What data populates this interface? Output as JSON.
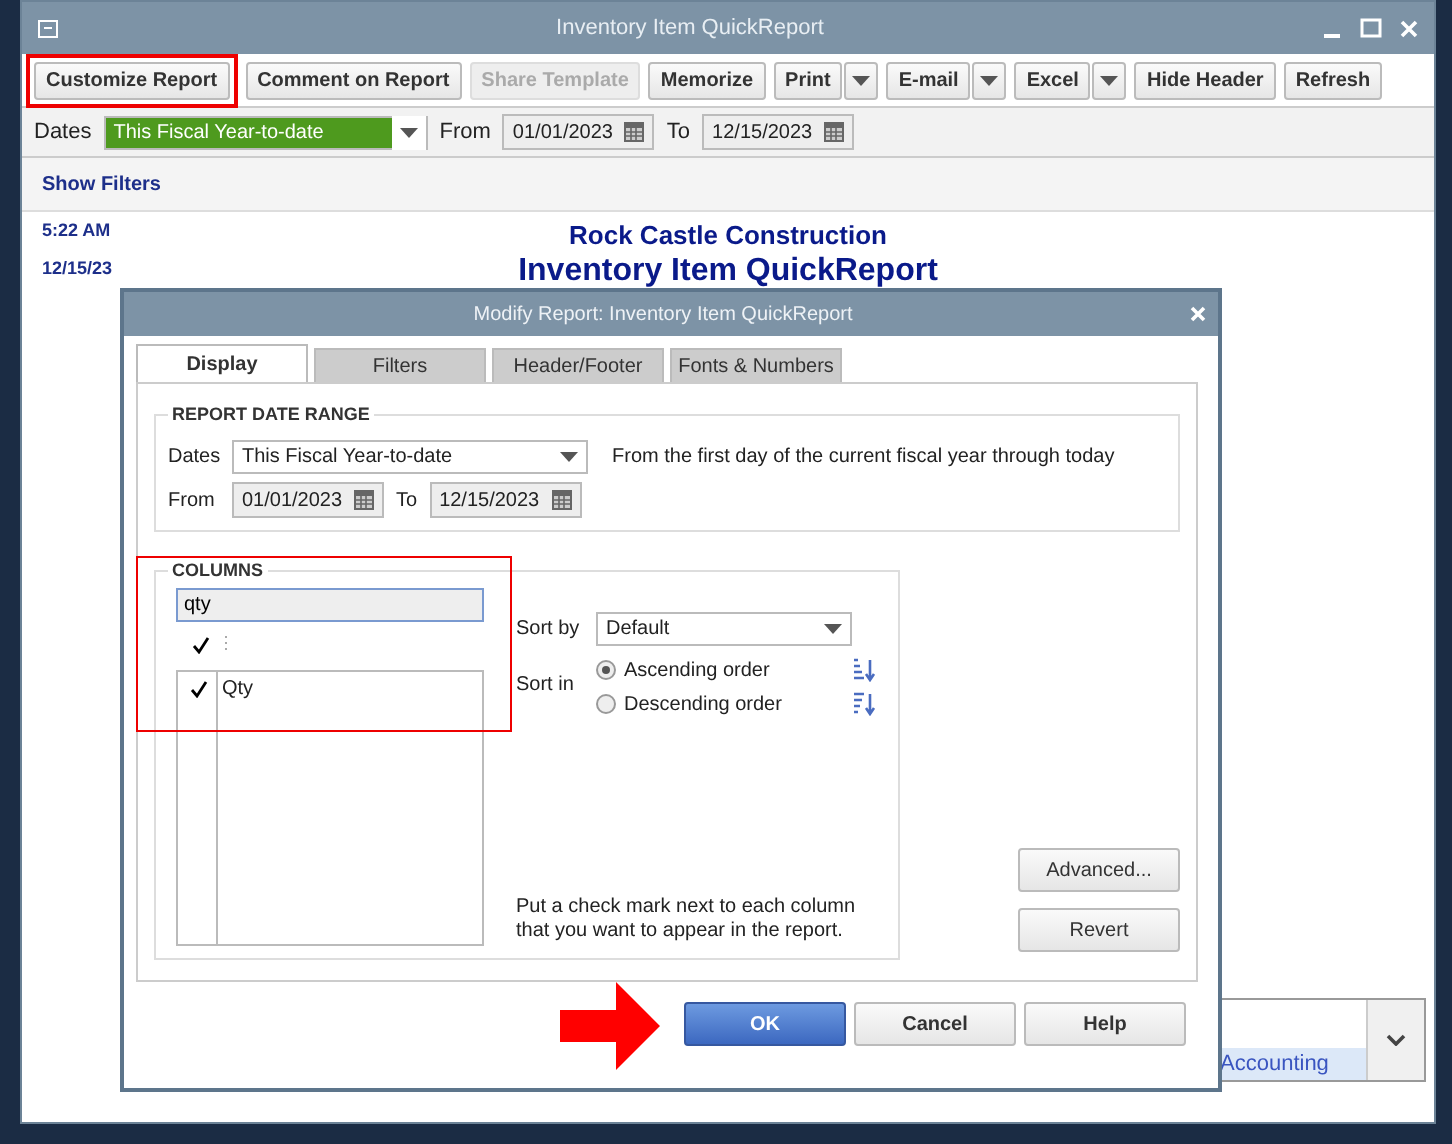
{
  "window": {
    "title": "Inventory Item QuickReport"
  },
  "toolbar": [
    {
      "label": "Customize Report",
      "kind": "button",
      "disabled": false,
      "highlighted": true
    },
    {
      "label": "Comment on Report",
      "kind": "button",
      "disabled": false,
      "highlighted": false
    },
    {
      "label": "Share Template",
      "kind": "button",
      "disabled": true,
      "highlighted": false
    },
    {
      "label": "Memorize",
      "kind": "button",
      "disabled": false,
      "highlighted": false
    },
    {
      "label": "Print",
      "kind": "split",
      "disabled": false,
      "highlighted": false
    },
    {
      "label": "E-mail",
      "kind": "split",
      "disabled": false,
      "highlighted": false
    },
    {
      "label": "Excel",
      "kind": "split",
      "disabled": false,
      "highlighted": false
    },
    {
      "label": "Hide Header",
      "kind": "button",
      "disabled": false,
      "highlighted": false
    },
    {
      "label": "Refresh",
      "kind": "button",
      "disabled": false,
      "highlighted": false
    }
  ],
  "filters": {
    "dates_label": "Dates",
    "dates_value": "This Fiscal Year-to-date",
    "from_label": "From",
    "from_value": "01/01/2023",
    "to_label": "To",
    "to_value": "12/15/2023"
  },
  "show_filters": "Show Filters",
  "report": {
    "time": "5:22 AM",
    "date": "12/15/23",
    "company": "Rock Castle Construction",
    "title": "Inventory Item QuickReport"
  },
  "bottom_panel": {
    "link": "Accounting"
  },
  "dialog": {
    "title": "Modify Report: Inventory Item QuickReport",
    "tabs": [
      {
        "label": "Display",
        "selected": true
      },
      {
        "label": "Filters",
        "selected": false
      },
      {
        "label": "Header/Footer",
        "selected": false
      },
      {
        "label": "Fonts & Numbers",
        "selected": false
      }
    ],
    "date_range": {
      "heading": "REPORT DATE RANGE",
      "dates_label": "Dates",
      "dates_value": "This Fiscal Year-to-date",
      "description": "From the first day of the current fiscal year through today",
      "from_label": "From",
      "from_value": "01/01/2023",
      "to_label": "To",
      "to_value": "12/15/2023"
    },
    "columns": {
      "heading": "COLUMNS",
      "highlighted": true,
      "search": {
        "value": "qty"
      },
      "header_checked": true,
      "items": [
        {
          "label": "Qty",
          "checked": true
        }
      ]
    },
    "sort": {
      "by_label": "Sort by",
      "by_value": "Default",
      "in_label": "Sort in",
      "orders": [
        {
          "label": "Ascending order",
          "selected": true,
          "kind": "asc"
        },
        {
          "label": "Descending order",
          "selected": false,
          "kind": "desc"
        }
      ]
    },
    "hint": "Put a check mark next to each column that you want to appear in the report.",
    "side_buttons": [
      "Advanced...",
      "Revert"
    ],
    "buttons": [
      {
        "label": "OK",
        "kind": "primary",
        "pointed": true
      },
      {
        "label": "Cancel",
        "kind": "normal",
        "pointed": false
      },
      {
        "label": "Help",
        "kind": "normal",
        "pointed": false
      }
    ]
  }
}
